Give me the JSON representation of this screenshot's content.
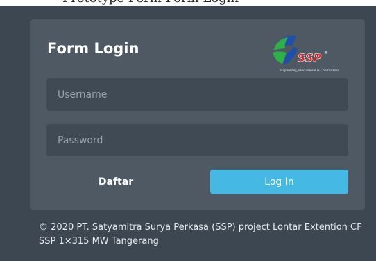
{
  "page": {
    "top_text": "Prototype Form Form Login"
  },
  "form": {
    "title": "Form Login",
    "username_placeholder": "Username",
    "password_placeholder": "Password",
    "register_label": "Daftar",
    "login_label": "Log In"
  },
  "logo": {
    "brand": "SSP",
    "registered_mark": "®",
    "tagline": "Engineering, Procurement & Construction"
  },
  "footer": {
    "text": "© 2020 PT. Satyamitra Surya Perkasa (SSP) project Lontar Extention CF SSP 1×315 MW Tangerang"
  },
  "colors": {
    "background": "#3c4752",
    "card": "#4e5964",
    "input": "#3f4a55",
    "accent": "#45b8e3",
    "logo_green": "#2db24a",
    "logo_blue": "#1f4fa8",
    "logo_red": "#d71920"
  }
}
